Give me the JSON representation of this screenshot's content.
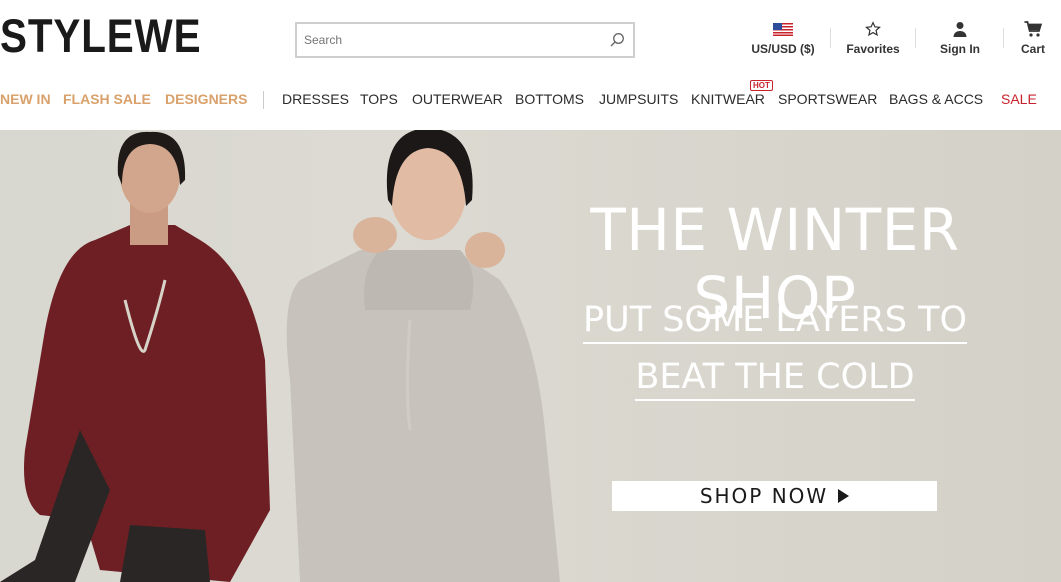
{
  "header": {
    "logo": "STYLEWE",
    "search": {
      "placeholder": "Search"
    },
    "utilities": {
      "currency": "US/USD ($)",
      "favorites": "Favorites",
      "sign_in": "Sign In",
      "cart": "Cart"
    }
  },
  "nav": {
    "featured": [
      "NEW IN",
      "FLASH SALE",
      "DESIGNERS"
    ],
    "categories": [
      "DRESSES",
      "TOPS",
      "OUTERWEAR",
      "BOTTOMS",
      "JUMPSUITS",
      "KNITWEAR",
      "SPORTSWEAR",
      "BAGS & ACCS"
    ],
    "sale": "SALE",
    "hot_badge": "HOT"
  },
  "hero": {
    "title": "THE WINTER SHOP",
    "subtitle_line1": "PUT SOME LAYERS TO",
    "subtitle_line2": "BEAT THE COLD",
    "cta": "SHOP NOW"
  },
  "colors": {
    "featured_nav": "#d9a16b",
    "sale": "#c8232c",
    "hero_bg": "#d8d7d0"
  }
}
